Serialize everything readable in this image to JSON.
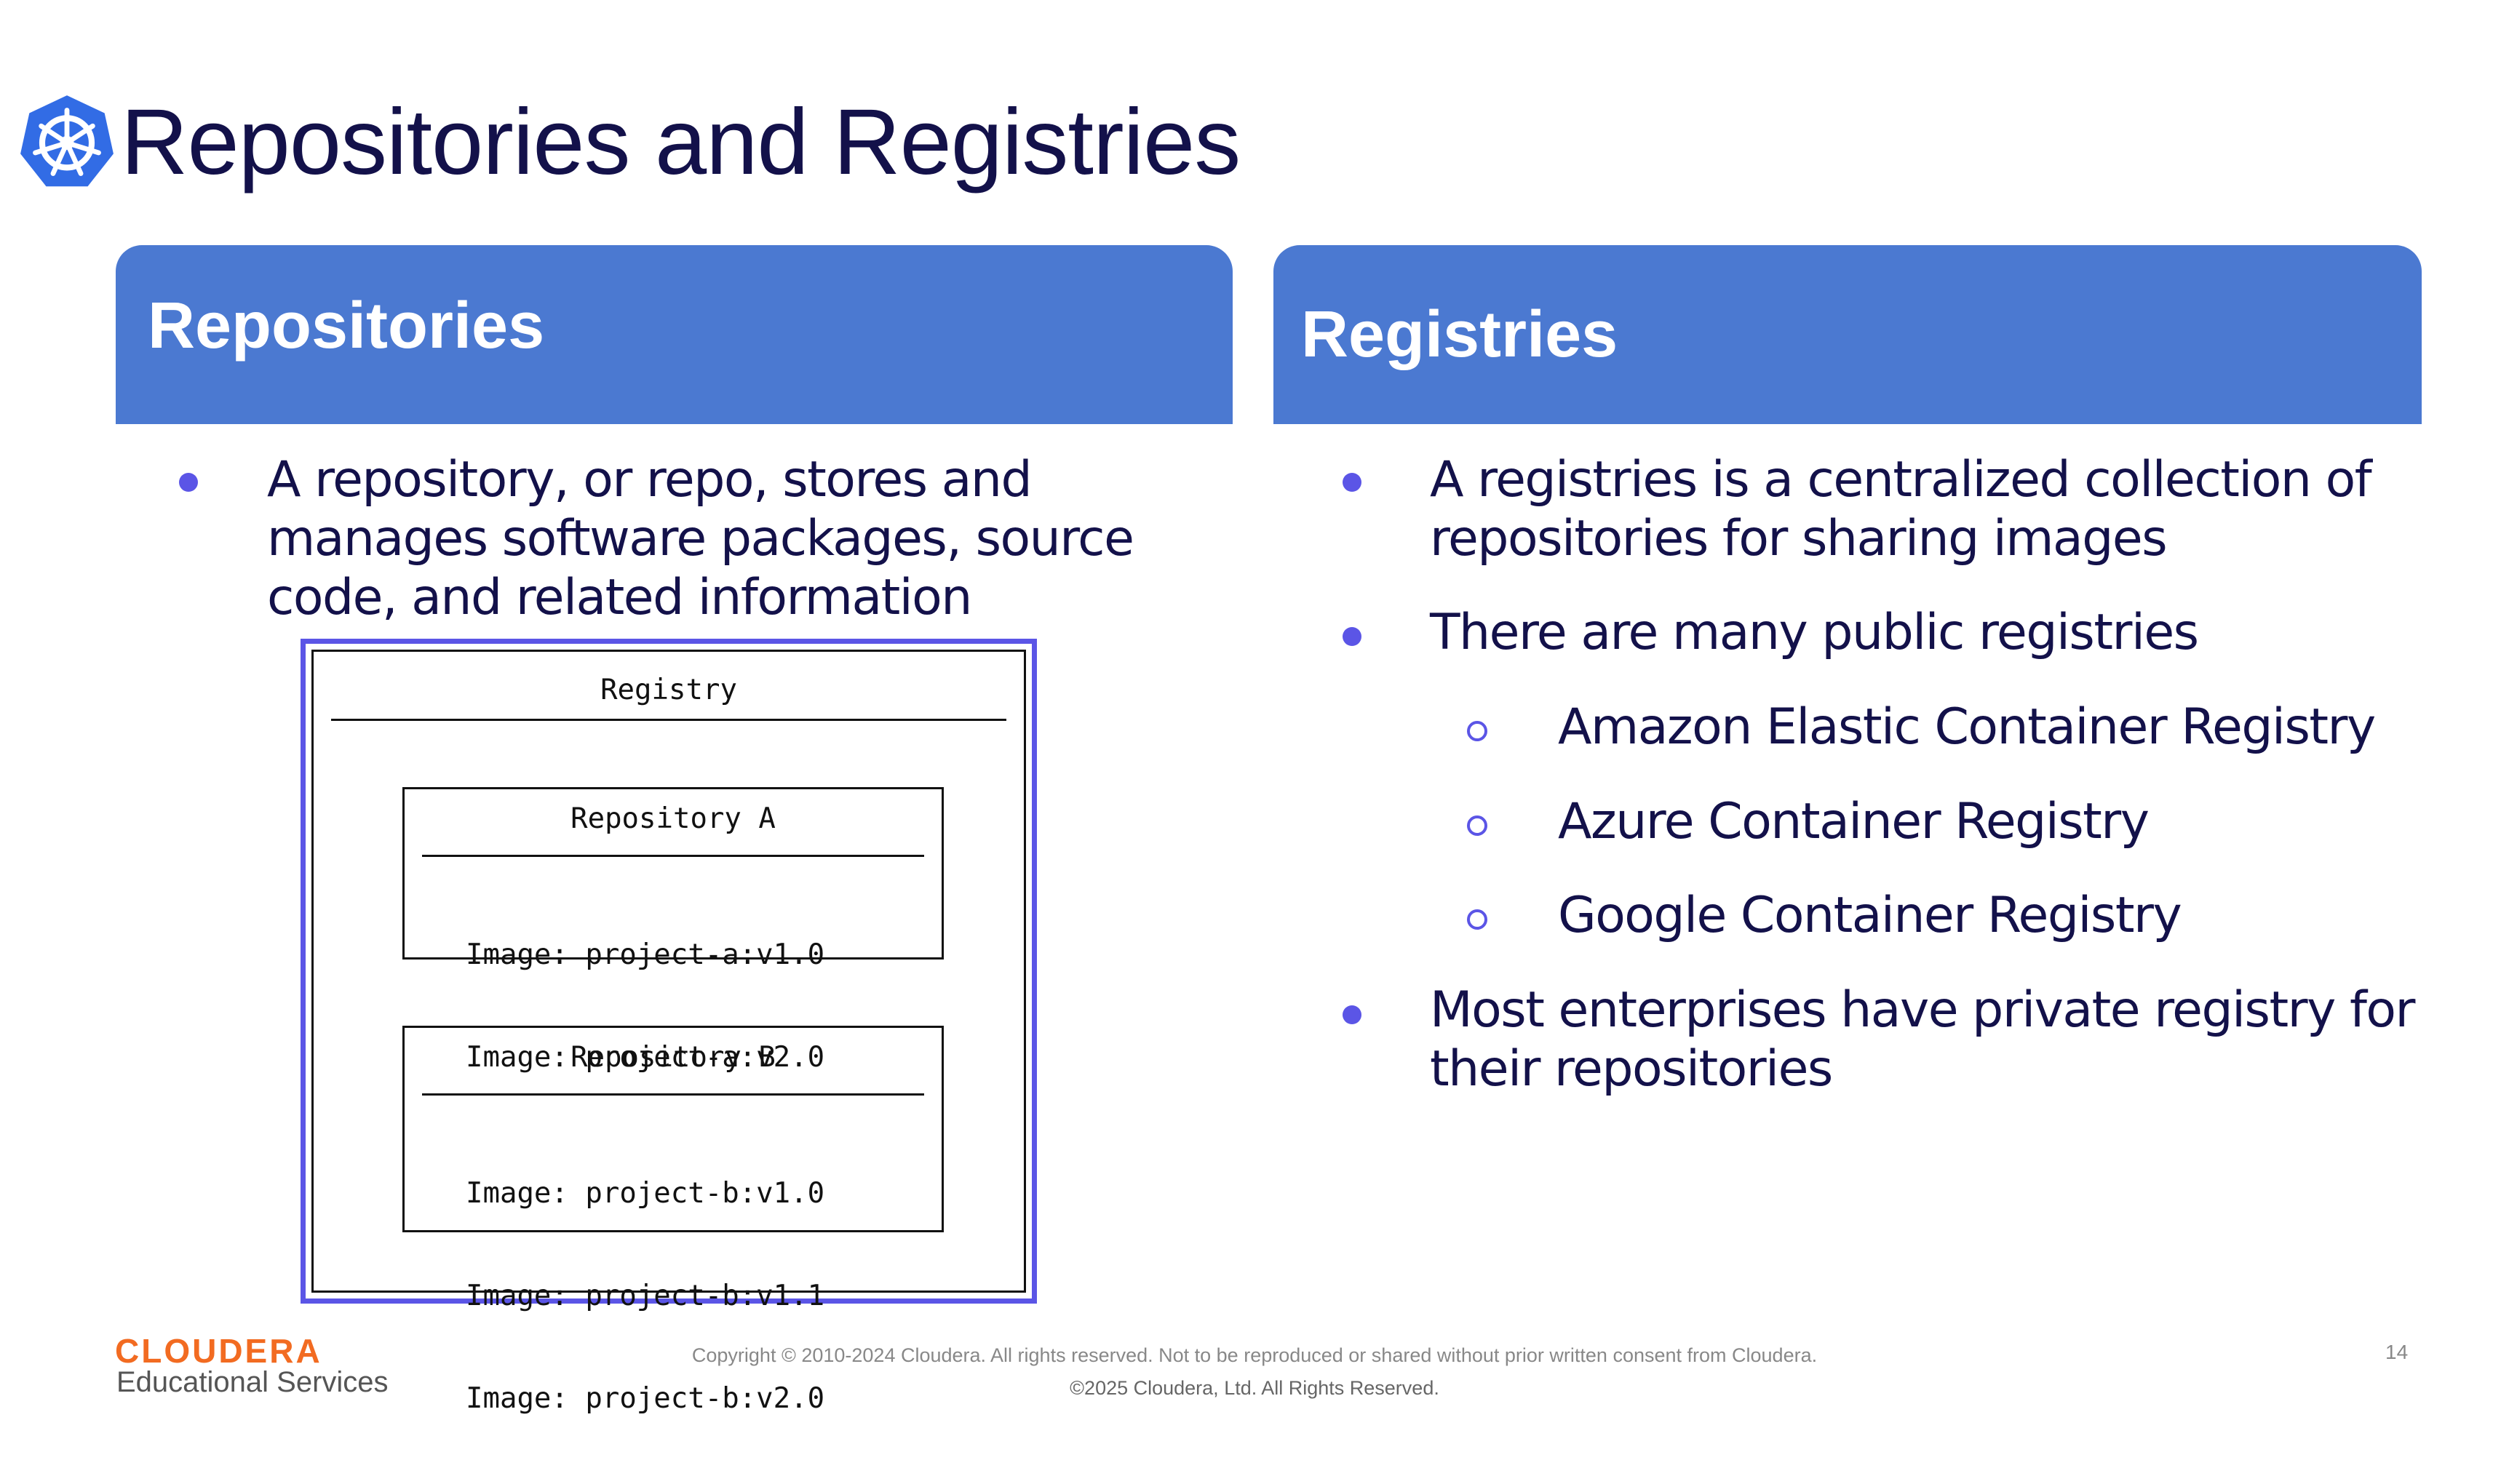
{
  "title": "Repositories and Registries",
  "icons": {
    "logo": "kubernetes-helm-icon"
  },
  "colors": {
    "header": "#4b79d1",
    "bullet": "#5b55e6",
    "title": "#13114a",
    "brand": "#f26b21"
  },
  "left_panel": {
    "heading": "Repositories",
    "bullets": [
      {
        "lines": [
          "A repository, or repo, stores and",
          "manages software packages, source",
          "code, and related information"
        ]
      }
    ]
  },
  "diagram": {
    "registry_label": "Registry",
    "repo_a": {
      "name": "Repository A",
      "images": [
        "Image: project-a:v1.0",
        "Image: project-a:v2.0"
      ]
    },
    "repo_b": {
      "name": "Repository B",
      "images": [
        "Image: project-b:v1.0",
        "Image: project-b:v1.1",
        "Image: project-b:v2.0"
      ]
    }
  },
  "right_panel": {
    "heading": "Registries",
    "bullets": [
      {
        "lines": [
          "A registries is a centralized collection of",
          "repositories for sharing images"
        ]
      },
      {
        "lines": [
          "There are many public registries"
        ]
      },
      {
        "lines": [
          "Most enterprises have private registry for",
          "their repositories"
        ]
      }
    ],
    "sub_bullets": [
      "Amazon Elastic Container Registry",
      "Azure Container Registry",
      "Google Container Registry"
    ]
  },
  "footer": {
    "brand": "CLOUDERA",
    "brand_sub": "Educational Services",
    "copyright_1": "Copyright © 2010-2024 Cloudera. All rights reserved. Not to be reproduced or shared without prior written consent from Cloudera.",
    "copyright_2": "©2025 Cloudera, Ltd. All Rights Reserved.",
    "page_number": "14"
  }
}
